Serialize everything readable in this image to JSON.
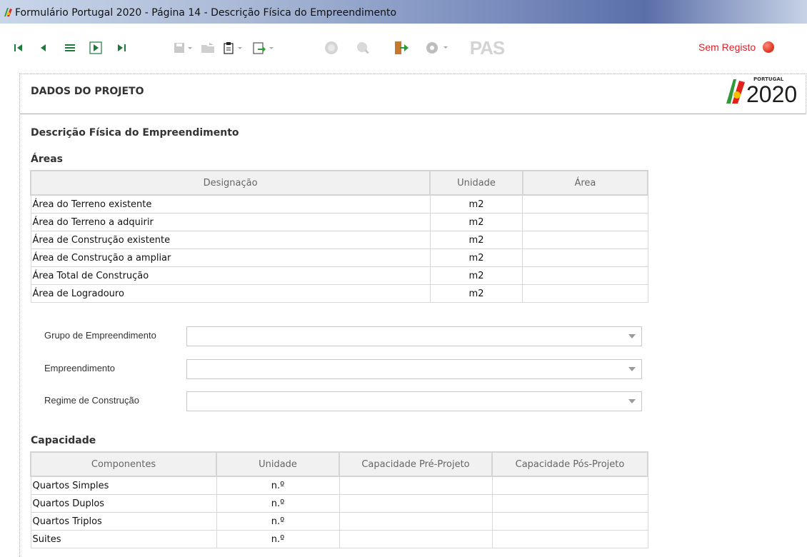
{
  "window": {
    "title": "Formulário Portugal 2020 - Página 14 - Descrição Física do Empreendimento"
  },
  "toolbar": {
    "status_label": "Sem Registo",
    "pas_label": "PAS"
  },
  "section": {
    "title": "DADOS DO PROJETO",
    "logo_small": "PORTUGAL",
    "logo_big": "2020"
  },
  "page": {
    "heading": "Descrição Física do Empreendimento",
    "areas_title": "Áreas",
    "areas_headers": [
      "Designação",
      "Unidade",
      "Área"
    ],
    "areas_rows": [
      {
        "designacao": "Área do Terreno existente",
        "unidade": "m2",
        "area": ""
      },
      {
        "designacao": "Área do Terreno a adquirir",
        "unidade": "m2",
        "area": ""
      },
      {
        "designacao": "Área de Construção existente",
        "unidade": "m2",
        "area": ""
      },
      {
        "designacao": "Área de Construção a ampliar",
        "unidade": "m2",
        "area": ""
      },
      {
        "designacao": "Área Total de Construção",
        "unidade": "m2",
        "area": ""
      },
      {
        "designacao": "Área de Logradouro",
        "unidade": "m2",
        "area": ""
      }
    ],
    "fields": [
      {
        "label": "Grupo de Empreendimento",
        "value": ""
      },
      {
        "label": "Empreendimento",
        "value": ""
      },
      {
        "label": "Regime de Construção",
        "value": ""
      }
    ],
    "capacidade_title": "Capacidade",
    "capacidade_headers": [
      "Componentes",
      "Unidade",
      "Capacidade Pré-Projeto",
      "Capacidade Pós-Projeto"
    ],
    "capacidade_rows": [
      {
        "componente": "Quartos Simples",
        "unidade": "n.º",
        "pre": "",
        "pos": ""
      },
      {
        "componente": "Quartos Duplos",
        "unidade": "n.º",
        "pre": "",
        "pos": ""
      },
      {
        "componente": "Quartos Triplos",
        "unidade": "n.º",
        "pre": "",
        "pos": ""
      },
      {
        "componente": "Suites",
        "unidade": "n.º",
        "pre": "",
        "pos": ""
      }
    ]
  }
}
